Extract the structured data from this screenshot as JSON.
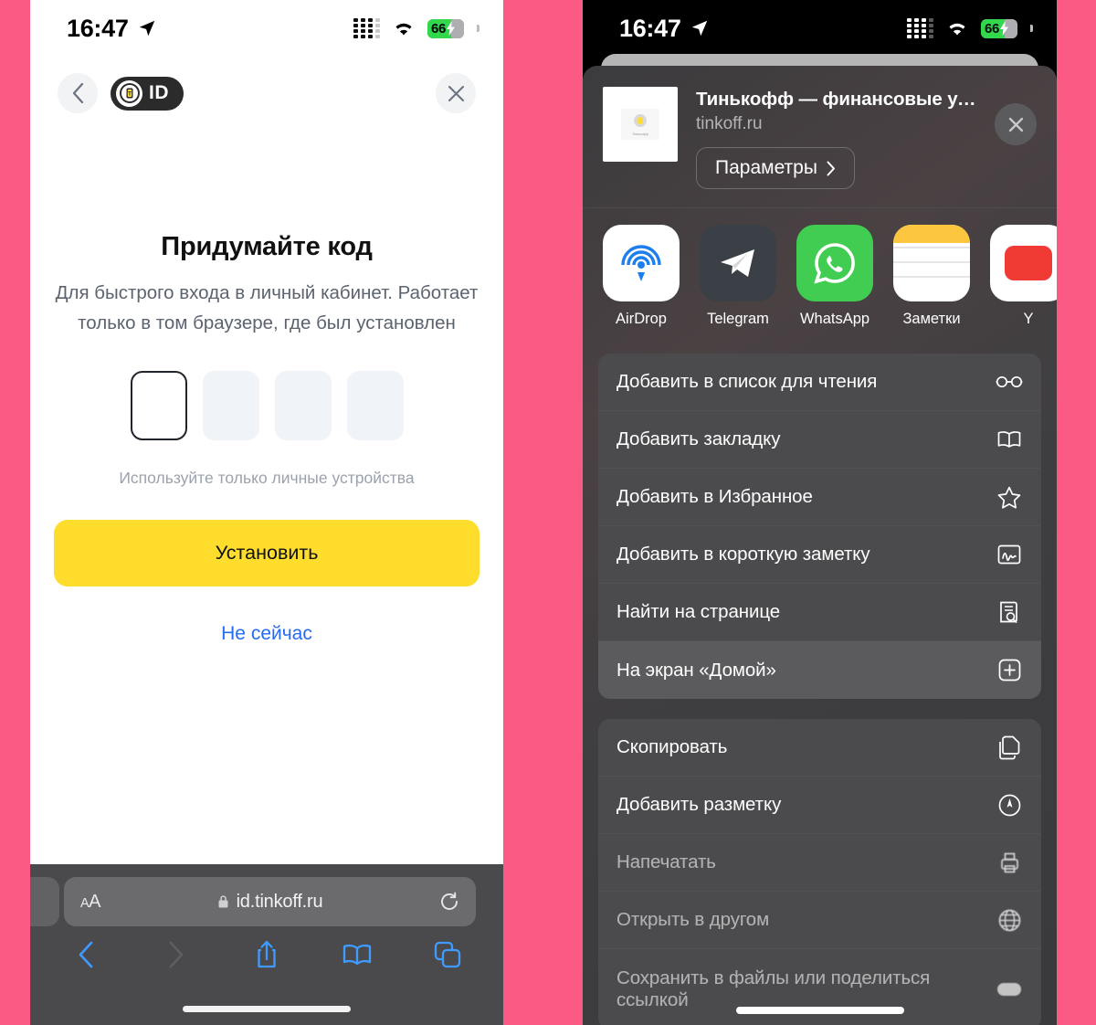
{
  "background_color": "#fb5a85",
  "left_phone": {
    "status_bar": {
      "time": "16:47",
      "battery_percent": "66",
      "location_icon": "location-arrow-icon",
      "wifi_icon": "wifi-icon",
      "signal_icon": "cellular-signal-icon",
      "charging_icon": "bolt-icon"
    },
    "nav": {
      "back_icon": "chevron-left-icon",
      "brand_label": "ID",
      "brand_emblem": "tinkoff-shield-icon",
      "close_icon": "close-x-icon"
    },
    "content": {
      "title": "Придумайте код",
      "subtitle": "Для быстрого входа в личный кабинет. Работает только в том браузере, где был установлен",
      "code_boxes": [
        {
          "active": true,
          "value": ""
        },
        {
          "active": false,
          "value": ""
        },
        {
          "active": false,
          "value": ""
        },
        {
          "active": false,
          "value": ""
        }
      ],
      "hint": "Используйте только личные устройства",
      "primary_button": "Установить",
      "secondary_link": "Не сейчас",
      "accent_color": "#ffdd2d",
      "link_color": "#246bf5"
    },
    "safari": {
      "font_size_label": "AA",
      "lock_icon": "lock-icon",
      "url": "id.tinkoff.ru",
      "reload_icon": "reload-icon",
      "toolbar": [
        {
          "name": "back",
          "icon": "chevron-left-icon",
          "enabled": true
        },
        {
          "name": "forward",
          "icon": "chevron-right-icon",
          "enabled": false
        },
        {
          "name": "share",
          "icon": "share-icon",
          "enabled": true
        },
        {
          "name": "bookmarks",
          "icon": "book-icon",
          "enabled": true
        },
        {
          "name": "tabs",
          "icon": "tabs-icon",
          "enabled": true
        }
      ]
    }
  },
  "right_phone": {
    "status_bar": {
      "time": "16:47",
      "battery_percent": "66"
    },
    "share_sheet": {
      "site_title": "Тинькофф — финансовые услуги...",
      "site_domain": "tinkoff.ru",
      "params_button": "Параметры",
      "params_chevron": "chevron-right-icon",
      "close_icon": "close-x-icon",
      "apps": [
        {
          "label": "AirDrop",
          "icon": "airdrop-icon"
        },
        {
          "label": "Telegram",
          "icon": "telegram-icon"
        },
        {
          "label": "WhatsApp",
          "icon": "whatsapp-icon"
        },
        {
          "label": "Заметки",
          "icon": "notes-icon"
        },
        {
          "label": "Y",
          "icon": "youtube-icon"
        }
      ],
      "menu_group_1": [
        {
          "label": "Добавить в список для чтения",
          "icon": "glasses-icon",
          "selected": false,
          "blurred": false
        },
        {
          "label": "Добавить закладку",
          "icon": "book-icon",
          "selected": false,
          "blurred": false
        },
        {
          "label": "Добавить в Избранное",
          "icon": "star-icon",
          "selected": false,
          "blurred": false
        },
        {
          "label": "Добавить в короткую заметку",
          "icon": "quick-note-icon",
          "selected": false,
          "blurred": false
        },
        {
          "label": "Найти на странице",
          "icon": "find-on-page-icon",
          "selected": false,
          "blurred": false
        },
        {
          "label": "На экран «Домой»",
          "icon": "add-to-home-icon",
          "selected": true,
          "blurred": false
        }
      ],
      "menu_group_2": [
        {
          "label": "Скопировать",
          "icon": "copy-icon",
          "selected": false,
          "blurred": false
        },
        {
          "label": "Добавить разметку",
          "icon": "markup-icon",
          "selected": false,
          "blurred": false
        },
        {
          "label": "Напечатать",
          "icon": "print-icon",
          "selected": false,
          "blurred": true
        },
        {
          "label": "Открыть в другом",
          "icon": "globe-icon",
          "selected": false,
          "blurred": true
        },
        {
          "label": "Сохранить в файлы или поделиться ссылкой",
          "icon": "pill-icon",
          "selected": false,
          "blurred": true
        }
      ]
    }
  }
}
